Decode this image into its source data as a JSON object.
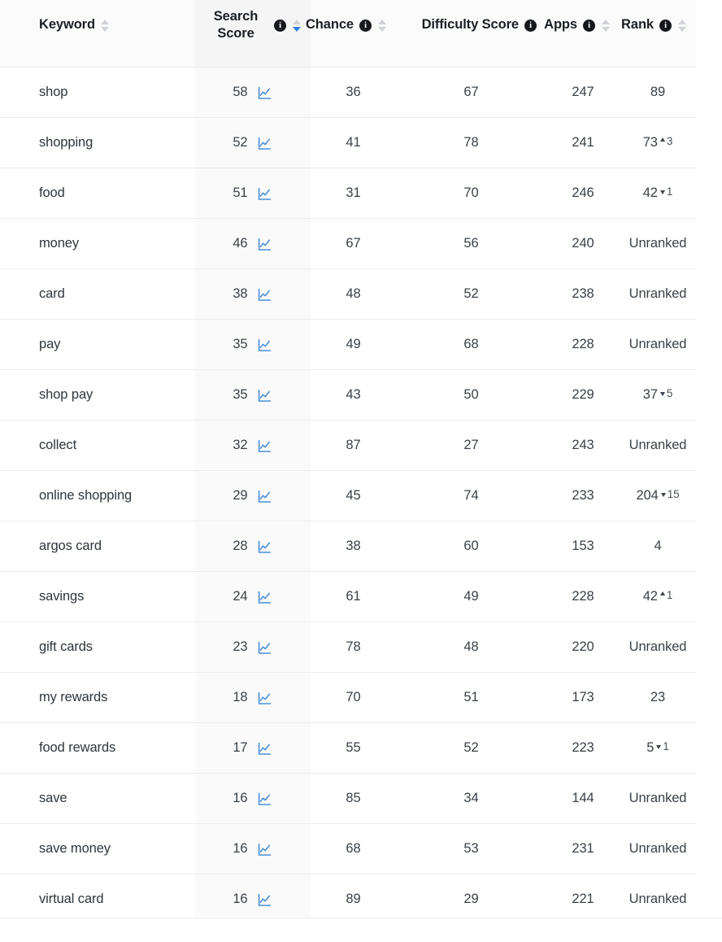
{
  "table": {
    "columns": [
      {
        "key": "keyword",
        "label": "Keyword",
        "align": "left",
        "has_info": false,
        "sortable": true,
        "sort_state": "none",
        "sorted": false
      },
      {
        "key": "search",
        "label": "Search Score",
        "align": "right",
        "has_info": true,
        "sortable": true,
        "sort_state": "desc",
        "sorted": true
      },
      {
        "key": "chance",
        "label": "Chance",
        "align": "right",
        "has_info": true,
        "sortable": true,
        "sort_state": "none",
        "sorted": false
      },
      {
        "key": "difficulty",
        "label": "Difficulty Score",
        "align": "right",
        "has_info": true,
        "sortable": false,
        "sort_state": "none",
        "sorted": false
      },
      {
        "key": "apps",
        "label": "Apps",
        "align": "right",
        "has_info": true,
        "sortable": true,
        "sort_state": "none",
        "sorted": false
      },
      {
        "key": "rank",
        "label": "Rank",
        "align": "right",
        "has_info": true,
        "sortable": true,
        "sort_state": "none",
        "sorted": false
      }
    ],
    "info_glyph": "i",
    "sparkline_icon": "line-chart-icon",
    "unranked_label": "Unranked",
    "rows": [
      {
        "keyword": "shop",
        "search_score": "58",
        "chance": "36",
        "difficulty": "67",
        "apps": "247",
        "rank": "89",
        "rank_delta": "",
        "rank_dir": "none"
      },
      {
        "keyword": "shopping",
        "search_score": "52",
        "chance": "41",
        "difficulty": "78",
        "apps": "241",
        "rank": "73",
        "rank_delta": "3",
        "rank_dir": "up"
      },
      {
        "keyword": "food",
        "search_score": "51",
        "chance": "31",
        "difficulty": "70",
        "apps": "246",
        "rank": "42",
        "rank_delta": "1",
        "rank_dir": "down"
      },
      {
        "keyword": "money",
        "search_score": "46",
        "chance": "67",
        "difficulty": "56",
        "apps": "240",
        "rank": "Unranked",
        "rank_delta": "",
        "rank_dir": "none"
      },
      {
        "keyword": "card",
        "search_score": "38",
        "chance": "48",
        "difficulty": "52",
        "apps": "238",
        "rank": "Unranked",
        "rank_delta": "",
        "rank_dir": "none"
      },
      {
        "keyword": "pay",
        "search_score": "35",
        "chance": "49",
        "difficulty": "68",
        "apps": "228",
        "rank": "Unranked",
        "rank_delta": "",
        "rank_dir": "none"
      },
      {
        "keyword": "shop pay",
        "search_score": "35",
        "chance": "43",
        "difficulty": "50",
        "apps": "229",
        "rank": "37",
        "rank_delta": "5",
        "rank_dir": "down"
      },
      {
        "keyword": "collect",
        "search_score": "32",
        "chance": "87",
        "difficulty": "27",
        "apps": "243",
        "rank": "Unranked",
        "rank_delta": "",
        "rank_dir": "none"
      },
      {
        "keyword": "online shopping",
        "search_score": "29",
        "chance": "45",
        "difficulty": "74",
        "apps": "233",
        "rank": "204",
        "rank_delta": "15",
        "rank_dir": "down"
      },
      {
        "keyword": "argos card",
        "search_score": "28",
        "chance": "38",
        "difficulty": "60",
        "apps": "153",
        "rank": "4",
        "rank_delta": "",
        "rank_dir": "none"
      },
      {
        "keyword": "savings",
        "search_score": "24",
        "chance": "61",
        "difficulty": "49",
        "apps": "228",
        "rank": "42",
        "rank_delta": "1",
        "rank_dir": "up"
      },
      {
        "keyword": "gift cards",
        "search_score": "23",
        "chance": "78",
        "difficulty": "48",
        "apps": "220",
        "rank": "Unranked",
        "rank_delta": "",
        "rank_dir": "none"
      },
      {
        "keyword": "my rewards",
        "search_score": "18",
        "chance": "70",
        "difficulty": "51",
        "apps": "173",
        "rank": "23",
        "rank_delta": "",
        "rank_dir": "none"
      },
      {
        "keyword": "food rewards",
        "search_score": "17",
        "chance": "55",
        "difficulty": "52",
        "apps": "223",
        "rank": "5",
        "rank_delta": "1",
        "rank_dir": "down"
      },
      {
        "keyword": "save",
        "search_score": "16",
        "chance": "85",
        "difficulty": "34",
        "apps": "144",
        "rank": "Unranked",
        "rank_delta": "",
        "rank_dir": "none"
      },
      {
        "keyword": "save money",
        "search_score": "16",
        "chance": "68",
        "difficulty": "53",
        "apps": "231",
        "rank": "Unranked",
        "rank_delta": "",
        "rank_dir": "none"
      },
      {
        "keyword": "virtual card",
        "search_score": "16",
        "chance": "89",
        "difficulty": "29",
        "apps": "221",
        "rank": "Unranked",
        "rank_delta": "",
        "rank_dir": "none"
      }
    ]
  },
  "colors": {
    "accent": "#2f80ed",
    "sorted_column_bg": "#fafafa",
    "header_bg": "#fbfbfb",
    "row_border": "#eceded",
    "text": "#3a4148",
    "info_badge": "#16181c"
  }
}
